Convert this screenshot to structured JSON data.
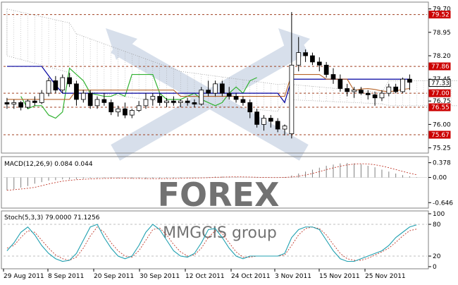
{
  "colors": {
    "frame": "#808080",
    "candle": "#000000",
    "tenkan": "#0000a0",
    "kijun": "#b8652a",
    "chikou": "#32b232",
    "cloud": "#9a9a9a",
    "level_line": "#a04020",
    "macd_hist": "#808080",
    "macd_signal": "#c0392b",
    "stoch_main": "#20a0b0",
    "stoch_signal": "#c0392b",
    "price_box_red": "#cc0000",
    "watermark": "#b8c6dc"
  },
  "watermark": {
    "brand": "FOREX",
    "sub": "MMGCIS group"
  },
  "main_panel": {
    "y_ticks": [
      "79.70",
      "78.95",
      "78.20",
      "77.45",
      "76.75",
      "76.00",
      "75.25"
    ],
    "level_labels": [
      {
        "text": "79.52",
        "price": 79.52,
        "style": "red"
      },
      {
        "text": "77.86",
        "price": 77.86,
        "style": "red"
      },
      {
        "text": "77.00",
        "price": 77.0,
        "style": "red"
      },
      {
        "text": "76.55",
        "price": 76.55,
        "style": "red"
      },
      {
        "text": "75.67",
        "price": 75.67,
        "style": "red"
      },
      {
        "text": "77.33",
        "price": 77.33,
        "style": "current"
      }
    ],
    "y_range": [
      75.15,
      79.85
    ]
  },
  "macd_panel": {
    "label": "MACD(12,26,9) 0.084 0.044",
    "y_ticks": [
      "0.378",
      "0.00",
      "-0.646"
    ],
    "y_range": [
      -0.75,
      0.48
    ]
  },
  "stoch_panel": {
    "label": "Stoch(5,3,3) 79.0000 71.1256",
    "y_ticks": [
      "100",
      "80",
      "20",
      "0"
    ],
    "levels": [
      80,
      20
    ]
  },
  "x_axis": {
    "labels": [
      "29 Aug 2011",
      "8 Sep 2011",
      "20 Sep 2011",
      "30 Sep 2011",
      "12 Oct 2011",
      "24 Oct 2011",
      "3 Nov 2011",
      "15 Nov 2011",
      "25 Nov 2011"
    ]
  },
  "chart_data": {
    "type": "candlestick",
    "ohlc": [
      [
        76.7,
        76.85,
        76.5,
        76.65
      ],
      [
        76.65,
        76.8,
        76.5,
        76.7
      ],
      [
        76.7,
        76.75,
        76.45,
        76.55
      ],
      [
        76.55,
        76.8,
        76.5,
        76.75
      ],
      [
        76.75,
        76.9,
        76.6,
        76.7
      ],
      [
        76.7,
        77.1,
        76.65,
        77.0
      ],
      [
        77.0,
        77.5,
        76.9,
        77.4
      ],
      [
        77.4,
        77.55,
        77.0,
        77.1
      ],
      [
        77.1,
        77.6,
        77.0,
        77.5
      ],
      [
        77.5,
        77.65,
        77.2,
        77.3
      ],
      [
        77.3,
        77.4,
        76.6,
        76.8
      ],
      [
        76.8,
        77.1,
        76.7,
        77.0
      ],
      [
        77.0,
        77.1,
        76.5,
        76.6
      ],
      [
        76.6,
        76.9,
        76.5,
        76.8
      ],
      [
        76.8,
        77.0,
        76.6,
        76.7
      ],
      [
        76.7,
        76.8,
        76.3,
        76.4
      ],
      [
        76.4,
        76.6,
        76.25,
        76.5
      ],
      [
        76.5,
        76.7,
        76.2,
        76.3
      ],
      [
        76.3,
        76.5,
        76.2,
        76.45
      ],
      [
        76.45,
        76.75,
        76.4,
        76.6
      ],
      [
        76.6,
        77.0,
        76.5,
        76.8
      ],
      [
        76.8,
        77.0,
        76.6,
        76.9
      ],
      [
        76.9,
        77.0,
        76.6,
        76.7
      ],
      [
        76.7,
        76.85,
        76.55,
        76.75
      ],
      [
        76.75,
        76.9,
        76.6,
        76.7
      ],
      [
        76.7,
        76.8,
        76.55,
        76.75
      ],
      [
        76.75,
        76.85,
        76.6,
        76.7
      ],
      [
        76.7,
        76.8,
        76.55,
        76.65
      ],
      [
        76.65,
        77.2,
        76.6,
        77.1
      ],
      [
        77.1,
        77.4,
        76.9,
        77.0
      ],
      [
        77.0,
        77.4,
        76.9,
        77.3
      ],
      [
        77.3,
        77.4,
        76.9,
        77.0
      ],
      [
        77.0,
        77.2,
        76.8,
        76.9
      ],
      [
        76.9,
        77.0,
        76.7,
        76.8
      ],
      [
        76.8,
        76.9,
        76.6,
        76.7
      ],
      [
        76.7,
        76.8,
        76.2,
        76.4
      ],
      [
        76.4,
        76.5,
        75.9,
        76.0
      ],
      [
        76.0,
        76.3,
        75.8,
        76.2
      ],
      [
        76.2,
        76.3,
        75.9,
        76.1
      ],
      [
        76.1,
        76.2,
        75.75,
        75.85
      ],
      [
        75.85,
        76.0,
        75.65,
        75.95
      ],
      [
        75.7,
        79.6,
        75.55,
        77.9
      ],
      [
        77.9,
        78.8,
        77.7,
        78.3
      ],
      [
        78.3,
        78.4,
        78.0,
        78.2
      ],
      [
        78.2,
        78.3,
        77.9,
        78.0
      ],
      [
        78.0,
        78.15,
        77.7,
        77.9
      ],
      [
        77.9,
        78.0,
        77.5,
        77.6
      ],
      [
        77.6,
        77.8,
        77.3,
        77.45
      ],
      [
        77.45,
        77.6,
        77.05,
        77.15
      ],
      [
        77.15,
        77.3,
        76.9,
        77.05
      ],
      [
        77.05,
        77.2,
        76.85,
        77.1
      ],
      [
        77.1,
        77.2,
        76.95,
        77.0
      ],
      [
        77.0,
        77.1,
        76.8,
        76.95
      ],
      [
        76.95,
        77.05,
        76.6,
        76.85
      ],
      [
        76.85,
        77.1,
        76.75,
        77.0
      ],
      [
        77.0,
        77.3,
        76.9,
        77.2
      ],
      [
        77.2,
        77.3,
        77.0,
        77.05
      ],
      [
        77.05,
        77.5,
        77.0,
        77.45
      ],
      [
        77.45,
        77.6,
        77.1,
        77.35
      ]
    ],
    "chikou": [
      76.9,
      76.5,
      76.6,
      76.6,
      76.3,
      76.2,
      76.4,
      77.8,
      77.6,
      77.4,
      77.0,
      76.95,
      76.9,
      76.9,
      77.0,
      76.9,
      77.6,
      77.6,
      77.6,
      77.6,
      77.0,
      76.8,
      76.8,
      76.8,
      76.9,
      77.0,
      76.8,
      76.7,
      76.6,
      76.7,
      77.0,
      77.2,
      77.0,
      77.4,
      77.5
    ],
    "macd_hist": [
      -0.33,
      -0.3,
      -0.26,
      -0.22,
      -0.16,
      -0.12,
      -0.08,
      -0.07,
      -0.05,
      -0.05,
      -0.04,
      -0.03,
      -0.02,
      -0.02,
      -0.02,
      -0.02,
      -0.02,
      -0.03,
      -0.03,
      -0.03,
      -0.04,
      -0.03,
      -0.03,
      -0.02,
      -0.02,
      -0.02,
      -0.01,
      -0.01,
      0.0,
      0.01,
      0.02,
      0.02,
      0.02,
      0.01,
      0.0,
      0.0,
      -0.01,
      0.0,
      0.0,
      0.0,
      0.01,
      0.05,
      0.1,
      0.15,
      0.2,
      0.25,
      0.3,
      0.33,
      0.36,
      0.37,
      0.36,
      0.34,
      0.3,
      0.26,
      0.2,
      0.15,
      0.1,
      0.06,
      0.03,
      0.01
    ],
    "stoch_main": [
      30,
      45,
      65,
      75,
      60,
      40,
      25,
      15,
      10,
      12,
      25,
      50,
      75,
      80,
      55,
      35,
      20,
      15,
      20,
      40,
      65,
      80,
      70,
      50,
      30,
      20,
      18,
      25,
      45,
      70,
      72,
      55,
      35,
      20,
      15,
      20,
      20,
      20,
      20,
      20,
      25,
      55,
      70,
      75,
      75,
      70,
      50,
      30,
      15,
      10,
      10,
      15,
      20,
      25,
      30,
      40,
      55,
      65,
      75,
      79
    ],
    "stoch_signal": [
      35,
      40,
      55,
      68,
      65,
      50,
      35,
      22,
      15,
      12,
      18,
      35,
      58,
      75,
      65,
      45,
      30,
      20,
      18,
      30,
      50,
      70,
      73,
      60,
      42,
      28,
      20,
      22,
      35,
      55,
      68,
      63,
      45,
      28,
      18,
      18,
      20,
      20,
      20,
      20,
      22,
      40,
      60,
      72,
      75,
      72,
      60,
      42,
      25,
      15,
      12,
      12,
      16,
      22,
      28,
      35,
      46,
      58,
      68,
      71
    ]
  }
}
